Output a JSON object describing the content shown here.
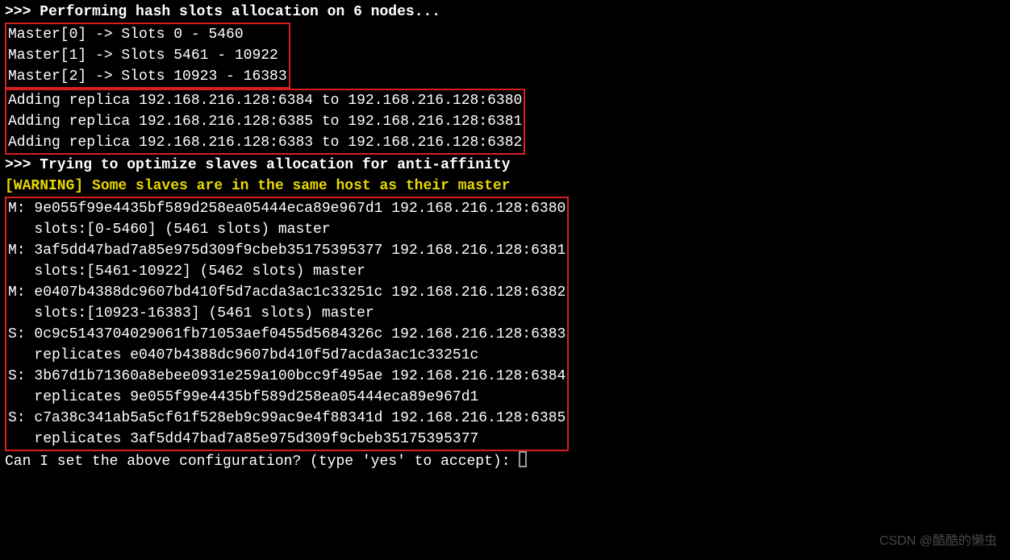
{
  "header": ">>> Performing hash slots allocation on 6 nodes...",
  "masters_box": [
    "Master[0] -> Slots 0 - 5460",
    "Master[1] -> Slots 5461 - 10922",
    "Master[2] -> Slots 10923 - 16383"
  ],
  "replicas_box": [
    "Adding replica 192.168.216.128:6384 to 192.168.216.128:6380",
    "Adding replica 192.168.216.128:6385 to 192.168.216.128:6381",
    "Adding replica 192.168.216.128:6383 to 192.168.216.128:6382"
  ],
  "optimize": ">>> Trying to optimize slaves allocation for anti-affinity",
  "warning": "[WARNING] Some slaves are in the same host as their master",
  "nodes_box": [
    "M: 9e055f99e4435bf589d258ea05444eca89e967d1 192.168.216.128:6380",
    "   slots:[0-5460] (5461 slots) master",
    "M: 3af5dd47bad7a85e975d309f9cbeb35175395377 192.168.216.128:6381",
    "   slots:[5461-10922] (5462 slots) master",
    "M: e0407b4388dc9607bd410f5d7acda3ac1c33251c 192.168.216.128:6382",
    "   slots:[10923-16383] (5461 slots) master",
    "S: 0c9c5143704029061fb71053aef0455d5684326c 192.168.216.128:6383",
    "   replicates e0407b4388dc9607bd410f5d7acda3ac1c33251c",
    "S: 3b67d1b71360a8ebee0931e259a100bcc9f495ae 192.168.216.128:6384",
    "   replicates 9e055f99e4435bf589d258ea05444eca89e967d1",
    "S: c7a38c341ab5a5cf61f528eb9c99ac9e4f88341d 192.168.216.128:6385",
    "   replicates 3af5dd47bad7a85e975d309f9cbeb35175395377"
  ],
  "prompt": "Can I set the above configuration? (type 'yes' to accept): ",
  "watermark": "CSDN @酷酷的懒虫"
}
